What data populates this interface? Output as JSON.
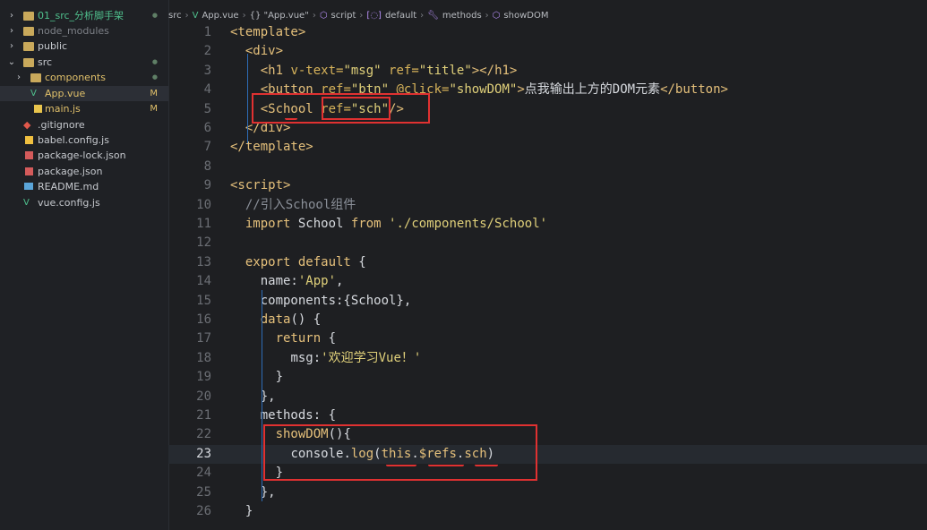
{
  "explorer": {
    "items": [
      {
        "label": "01_src_分析脚手架",
        "kind": "folder",
        "expanded": false,
        "badge": "●",
        "color": "#4fc08d"
      },
      {
        "label": "node_modules",
        "kind": "folder",
        "expanded": false,
        "badge": "",
        "color": "#7d8087"
      },
      {
        "label": "public",
        "kind": "folder",
        "expanded": false,
        "badge": "",
        "color": "#c6c9ce"
      },
      {
        "label": "src",
        "kind": "folder",
        "expanded": true,
        "badge": "●",
        "color": "#c6c9ce"
      },
      {
        "label": "components",
        "kind": "folder",
        "expanded": false,
        "badge": "●",
        "color": "#e0c06a"
      },
      {
        "label": "App.vue",
        "kind": "vue",
        "badge": "M",
        "color": "#e0c06a"
      },
      {
        "label": "main.js",
        "kind": "js",
        "badge": "M",
        "color": "#e0c06a"
      },
      {
        "label": ".gitignore",
        "kind": "git",
        "badge": "",
        "color": "#c6c9ce"
      },
      {
        "label": "babel.config.js",
        "kind": "babel",
        "badge": "",
        "color": "#c6c9ce"
      },
      {
        "label": "package-lock.json",
        "kind": "json",
        "badge": "",
        "color": "#c6c9ce"
      },
      {
        "label": "package.json",
        "kind": "json",
        "badge": "",
        "color": "#c6c9ce"
      },
      {
        "label": "README.md",
        "kind": "md",
        "badge": "",
        "color": "#c6c9ce"
      },
      {
        "label": "vue.config.js",
        "kind": "vue",
        "badge": "",
        "color": "#c6c9ce"
      }
    ]
  },
  "breadcrumb": {
    "src": "src",
    "file": "App.vue",
    "section": "{} \"App.vue\"",
    "script": "script",
    "default": "default",
    "methods": "methods",
    "showDOM": "showDOM"
  },
  "editor": {
    "current_line": 23,
    "lines": [
      {
        "n": "1",
        "tokens": [
          [
            "tag",
            "<template>"
          ]
        ]
      },
      {
        "n": "2",
        "tokens": [
          [
            "plain",
            "  "
          ],
          [
            "tag",
            "<div>"
          ]
        ]
      },
      {
        "n": "3",
        "tokens": [
          [
            "plain",
            "    "
          ],
          [
            "tag",
            "<h1 "
          ],
          [
            "attr",
            "v-text="
          ],
          [
            "str",
            "\"msg\""
          ],
          [
            "attr",
            " ref="
          ],
          [
            "str",
            "\"title\""
          ],
          [
            "tag",
            "></h1>"
          ]
        ]
      },
      {
        "n": "4",
        "tokens": [
          [
            "plain",
            "    "
          ],
          [
            "tag",
            "<button "
          ],
          [
            "attr",
            "ref="
          ],
          [
            "str",
            "\"btn\""
          ],
          [
            "attr",
            " @click="
          ],
          [
            "str",
            "\"showDOM\""
          ],
          [
            "tag",
            ">"
          ],
          [
            "plain",
            "点我输出上方的DOM元素"
          ],
          [
            "tag",
            "</button>"
          ]
        ]
      },
      {
        "n": "5",
        "tokens": [
          [
            "plain",
            "    "
          ],
          [
            "tag",
            "<School "
          ],
          [
            "attr",
            "ref="
          ],
          [
            "str",
            "\"sch\""
          ],
          [
            "tag",
            "/>"
          ]
        ]
      },
      {
        "n": "6",
        "tokens": [
          [
            "plain",
            "  "
          ],
          [
            "tag",
            "</div>"
          ]
        ]
      },
      {
        "n": "7",
        "tokens": [
          [
            "tag",
            "</template>"
          ]
        ]
      },
      {
        "n": "8",
        "tokens": []
      },
      {
        "n": "9",
        "tokens": [
          [
            "tag",
            "<script>"
          ]
        ]
      },
      {
        "n": "10",
        "tokens": [
          [
            "plain",
            "  "
          ],
          [
            "cmt",
            "//引入School组件"
          ]
        ]
      },
      {
        "n": "11",
        "tokens": [
          [
            "plain",
            "  "
          ],
          [
            "kw",
            "import "
          ],
          [
            "plain",
            "School "
          ],
          [
            "kw",
            "from "
          ],
          [
            "str",
            "'./components/School'"
          ]
        ]
      },
      {
        "n": "12",
        "tokens": []
      },
      {
        "n": "13",
        "tokens": [
          [
            "plain",
            "  "
          ],
          [
            "kw",
            "export default "
          ],
          [
            "plain",
            "{"
          ]
        ]
      },
      {
        "n": "14",
        "tokens": [
          [
            "plain",
            "    "
          ],
          [
            "plain",
            "name:"
          ],
          [
            "str",
            "'App'"
          ],
          [
            "plain",
            ","
          ]
        ]
      },
      {
        "n": "15",
        "tokens": [
          [
            "plain",
            "    "
          ],
          [
            "plain",
            "components:{School},"
          ]
        ]
      },
      {
        "n": "16",
        "tokens": [
          [
            "plain",
            "    "
          ],
          [
            "fn",
            "data"
          ],
          [
            "plain",
            "() {"
          ]
        ]
      },
      {
        "n": "17",
        "tokens": [
          [
            "plain",
            "      "
          ],
          [
            "kw",
            "return "
          ],
          [
            "plain",
            "{"
          ]
        ]
      },
      {
        "n": "18",
        "tokens": [
          [
            "plain",
            "        "
          ],
          [
            "plain",
            "msg:"
          ],
          [
            "str",
            "'欢迎学习Vue！'"
          ]
        ]
      },
      {
        "n": "19",
        "tokens": [
          [
            "plain",
            "      }"
          ]
        ]
      },
      {
        "n": "20",
        "tokens": [
          [
            "plain",
            "    },"
          ]
        ]
      },
      {
        "n": "21",
        "tokens": [
          [
            "plain",
            "    "
          ],
          [
            "plain",
            "methods: {"
          ]
        ]
      },
      {
        "n": "22",
        "tokens": [
          [
            "plain",
            "      "
          ],
          [
            "fn",
            "showDOM"
          ],
          [
            "plain",
            "(){"
          ]
        ]
      },
      {
        "n": "23",
        "tokens": [
          [
            "plain",
            "        "
          ],
          [
            "plain",
            "console."
          ],
          [
            "fn",
            "log"
          ],
          [
            "plain",
            "("
          ],
          [
            "kw",
            "this"
          ],
          [
            "plain",
            "."
          ],
          [
            "fn",
            "$refs"
          ],
          [
            "plain",
            "."
          ],
          [
            "fn",
            "sch"
          ],
          [
            "plain",
            ")"
          ]
        ]
      },
      {
        "n": "24",
        "tokens": [
          [
            "plain",
            "      }"
          ]
        ]
      },
      {
        "n": "25",
        "tokens": [
          [
            "plain",
            "    },"
          ]
        ]
      },
      {
        "n": "26",
        "tokens": [
          [
            "plain",
            "  }"
          ]
        ]
      }
    ]
  }
}
